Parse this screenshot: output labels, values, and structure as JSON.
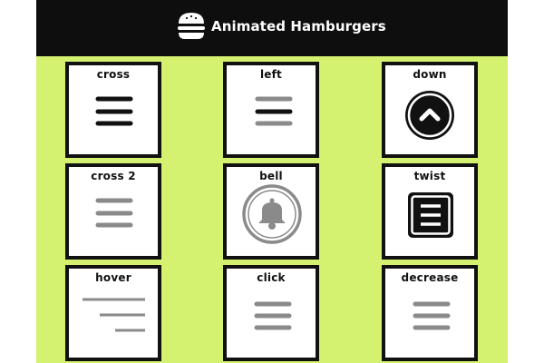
{
  "header": {
    "title": "Animated Hamburgers",
    "logo_icon": "burger-icon"
  },
  "colors": {
    "background": "#d4f16f",
    "header": "#0e0e0e",
    "card_border": "#111111",
    "bar_dark": "#111111",
    "bar_gray": "#8a8a8a"
  },
  "cards": [
    {
      "id": "cross",
      "label": "cross",
      "icon": "hamburger-menu-icon"
    },
    {
      "id": "left",
      "label": "left",
      "icon": "hamburger-menu-icon"
    },
    {
      "id": "down",
      "label": "down",
      "icon": "chevron-up-circle-icon"
    },
    {
      "id": "cross-2",
      "label": "cross 2",
      "icon": "hamburger-menu-icon"
    },
    {
      "id": "bell",
      "label": "bell",
      "icon": "bell-icon"
    },
    {
      "id": "twist",
      "label": "twist",
      "icon": "boxed-menu-icon"
    },
    {
      "id": "hover",
      "label": "hover",
      "icon": "staggered-lines-icon"
    },
    {
      "id": "click",
      "label": "click",
      "icon": "hamburger-menu-icon"
    },
    {
      "id": "decrease",
      "label": "decrease",
      "icon": "hamburger-menu-icon"
    }
  ]
}
